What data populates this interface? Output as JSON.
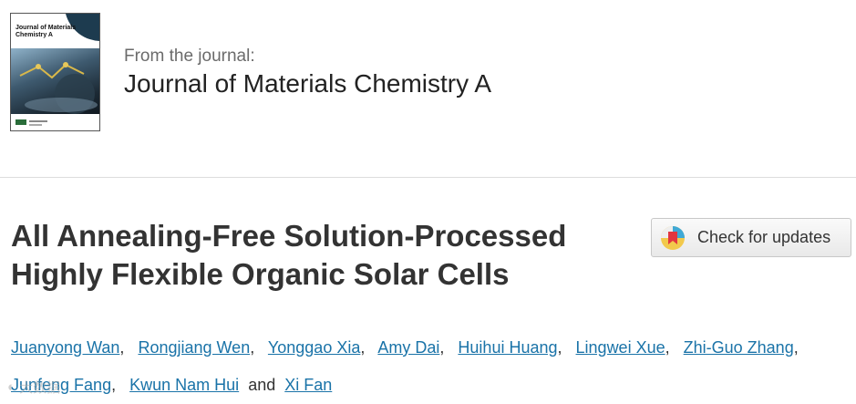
{
  "journal": {
    "cover_title": "Journal of Materials Chemistry A",
    "from_label": "From the journal:",
    "name": "Journal of Materials Chemistry A"
  },
  "article": {
    "title": "All Annealing-Free Solution-Processed Highly Flexible Organic Solar Cells"
  },
  "updates_button": {
    "label": "Check for updates"
  },
  "authors": [
    "Juanyong Wan",
    "Rongjiang Wen",
    "Yonggao Xia",
    "Amy Dai",
    "Huihui Huang",
    "Lingwei Xue",
    "Zhi-Guo Zhang",
    "Junfeng Fang",
    "Kwun Nam Hui",
    "Xi Fan"
  ],
  "author_separator": ",",
  "author_conjunction": "and",
  "watermark": "大数据"
}
